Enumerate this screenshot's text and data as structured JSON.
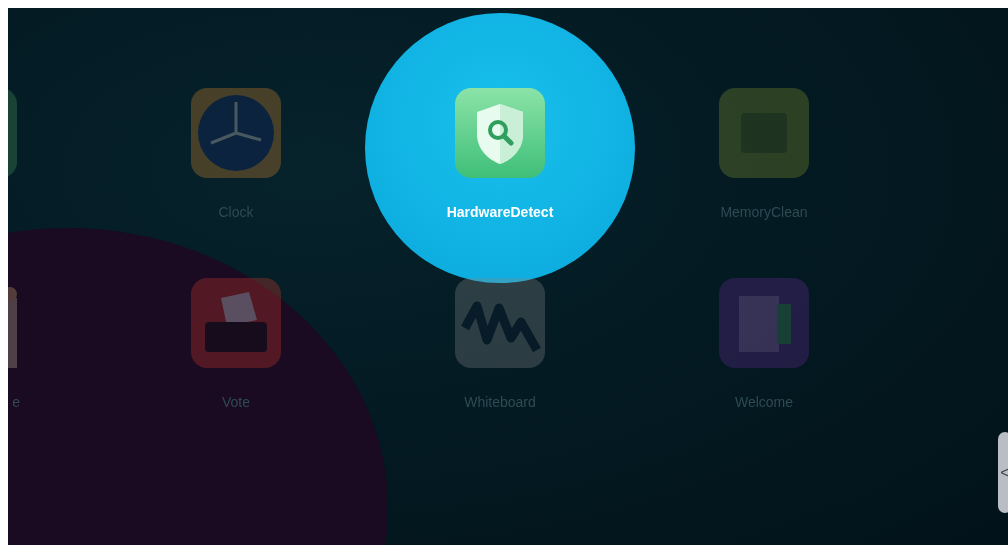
{
  "rows": [
    {
      "apps": [
        {
          "kind": "partial-green",
          "selected": false
        },
        {
          "kind": "clock",
          "label": "Clock",
          "selected": false
        },
        {
          "kind": "shield",
          "label": "HardwareDetect",
          "selected": true
        },
        {
          "kind": "memory",
          "label": "MemoryClean",
          "selected": false
        }
      ]
    },
    {
      "apps": [
        {
          "kind": "partial-figure",
          "label": "e",
          "selected": false
        },
        {
          "kind": "vote",
          "label": "Vote",
          "selected": false
        },
        {
          "kind": "whiteboard",
          "label": "Whiteboard",
          "selected": false
        },
        {
          "kind": "welcome",
          "label": "Welcome",
          "selected": false
        }
      ]
    }
  ],
  "side_handle": {
    "glyph": "<"
  }
}
